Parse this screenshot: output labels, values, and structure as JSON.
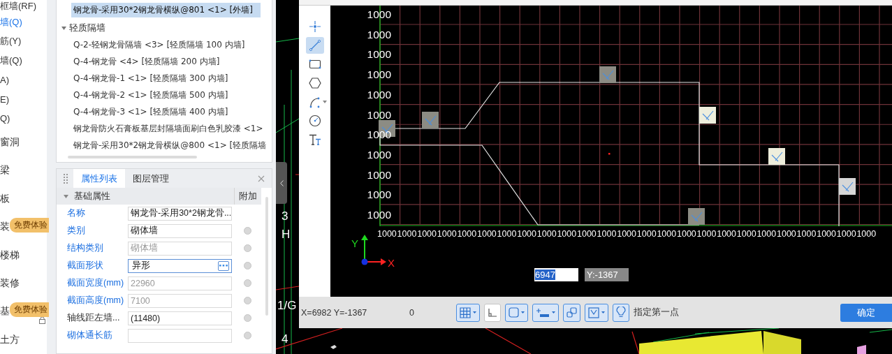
{
  "nav": {
    "items": [
      {
        "label": "框墙(RF)",
        "kind": "sub",
        "selected": false
      },
      {
        "label": "墙(Q)",
        "kind": "sub",
        "selected": true
      },
      {
        "label": "筋(Y)",
        "kind": "sub",
        "selected": false
      },
      {
        "label": "墙(Q)",
        "kind": "sub",
        "selected": false
      },
      {
        "label": "A)",
        "kind": "sub",
        "selected": false
      },
      {
        "label": "E)",
        "kind": "sub",
        "selected": false
      },
      {
        "label": "Q)",
        "kind": "sub",
        "selected": false
      },
      {
        "label": "窗洞",
        "kind": "category",
        "selected": false
      },
      {
        "label": "梁",
        "kind": "category",
        "selected": false
      },
      {
        "label": "板",
        "kind": "category",
        "selected": false
      },
      {
        "label": "装",
        "kind": "category",
        "selected": false,
        "badge": "免费体验"
      },
      {
        "label": "楼梯",
        "kind": "category",
        "selected": false
      },
      {
        "label": "装修",
        "kind": "category",
        "selected": false
      },
      {
        "label": "基",
        "kind": "category",
        "selected": false,
        "badge": "免费体验",
        "locked": true
      },
      {
        "label": "土方",
        "kind": "category",
        "selected": false
      }
    ]
  },
  "tree": [
    {
      "label": "钢龙骨-采用30*2钢龙骨横纵@801 <1> [外墙]",
      "selected": true
    },
    {
      "label": "轻质隔墙",
      "selected": false,
      "expanded": true,
      "children": [
        {
          "label": "Q-2-轻钢龙骨隔墙 <3> [轻质隔墙 100 内墙]",
          "selected": false
        },
        {
          "label": "Q-4-钢龙骨 <4> [轻质隔墙 200 内墙]",
          "selected": false
        },
        {
          "label": "Q-4-钢龙骨-1 <1> [轻质隔墙 300 内墙]",
          "selected": false
        },
        {
          "label": "Q-4-钢龙骨-2 <1> [轻质隔墙 500 内墙]",
          "selected": false
        },
        {
          "label": "Q-4-钢龙骨-3 <1> [轻质隔墙 400 内墙]",
          "selected": false
        },
        {
          "label": "钢龙骨防火石膏板基层封隔墙面刷白色乳胶漆 <1>",
          "selected": false
        },
        {
          "label": "钢龙骨-采用30*2钢龙骨横纵@800 <1> [轻质隔墙",
          "selected": false
        }
      ]
    }
  ],
  "properties": {
    "tabs": [
      {
        "label": "属性列表",
        "selected": true
      },
      {
        "label": "图层管理",
        "selected": false
      }
    ],
    "section": {
      "label": "基础属性",
      "expanded": true
    },
    "extra_header": "附加",
    "rows": [
      {
        "label": "名称",
        "value": "钢龙骨-采用30*2钢龙骨...",
        "public": true,
        "disabled": false
      },
      {
        "label": "类别",
        "value": "砌体墙",
        "public": true,
        "disabled": false,
        "attached": false
      },
      {
        "label": "结构类别",
        "value": "砌体墙",
        "public": true,
        "disabled": true,
        "attached": false
      },
      {
        "label": "截面形状",
        "value": "异形",
        "public": true,
        "disabled": false,
        "focused": true,
        "kind": "ellipsis",
        "attached": false
      },
      {
        "label": "截面宽度(mm)",
        "value": "22960",
        "public": true,
        "disabled": true,
        "attached": false
      },
      {
        "label": "截面高度(mm)",
        "value": "7100",
        "public": true,
        "disabled": true,
        "attached": false
      },
      {
        "label": "轴线距左墙...",
        "value": "(11480)",
        "public": false,
        "disabled": false,
        "attached": false
      },
      {
        "label": "砌体通长筋",
        "public": true,
        "disabled": false,
        "attached": false
      }
    ]
  },
  "scene": {
    "axis_labels": [
      "3",
      "H",
      "1/G",
      "4"
    ]
  },
  "cad": {
    "tools": [
      {
        "kind": "point",
        "selected": false
      },
      {
        "kind": "line",
        "selected": true
      },
      {
        "kind": "rect",
        "selected": false
      },
      {
        "kind": "polygon",
        "selected": false
      },
      {
        "kind": "arc",
        "selected": false,
        "dropdown": true
      },
      {
        "kind": "circle",
        "selected": false
      },
      {
        "kind": "text",
        "selected": false
      }
    ],
    "y_labels": [
      "1000",
      "1000",
      "1000",
      "1000",
      "1000",
      "1000",
      "1000",
      "1000",
      "1000",
      "1000",
      "1000"
    ],
    "x_labels": [
      "1000",
      "1000",
      "1000",
      "1000",
      "1000",
      "1000",
      "1000",
      "1000",
      "1000",
      "1000",
      "1000",
      "1000",
      "1000",
      "1000",
      "1000",
      "1000",
      "1000",
      "1000",
      "1000",
      "1000",
      "1000",
      "1000",
      "1000",
      "1000",
      "1000"
    ],
    "axis_icon": {
      "x_label": "X",
      "y_label": "Y"
    },
    "coord_input": {
      "x_value": "6947",
      "y_value": "Y:-1367"
    },
    "status": {
      "coords": "X=6982 Y=-1367",
      "value": "0",
      "prompt": "指定第一点",
      "toggles": [
        {
          "kind": "grid",
          "on": true,
          "dropdown": true
        },
        {
          "kind": "ortho",
          "on": false,
          "dropdown": false
        },
        {
          "kind": "rect",
          "on": true,
          "dropdown": true
        },
        {
          "kind": "dynamic",
          "on": true,
          "dropdown": true
        },
        {
          "kind": "offset",
          "on": true,
          "dropdown": false
        },
        {
          "kind": "snap",
          "on": true,
          "dropdown": true
        },
        {
          "kind": "hint",
          "on": true,
          "dropdown": false
        }
      ],
      "ok_button": "确定"
    }
  }
}
